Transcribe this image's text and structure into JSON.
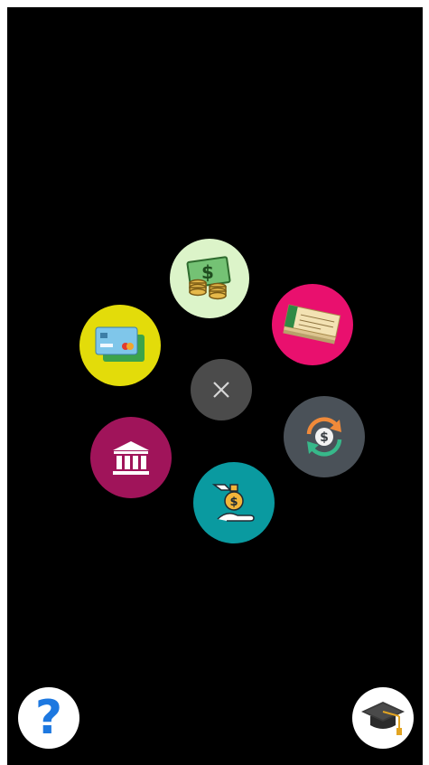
{
  "radial_menu": {
    "items": [
      {
        "icon": "cash-icon",
        "bg": "#dcf4c9"
      },
      {
        "icon": "cheque-icon",
        "bg": "#e9106e"
      },
      {
        "icon": "credit-card-icon",
        "bg": "#e3dc0a"
      },
      {
        "icon": "currency-exchange-icon",
        "bg": "#4a5158"
      },
      {
        "icon": "bank-icon",
        "bg": "#a0145a"
      },
      {
        "icon": "loan-icon",
        "bg": "#0a9aa0"
      }
    ],
    "close": {
      "icon": "close-icon",
      "label": "×",
      "bg": "#4b4b4b"
    }
  },
  "footer": {
    "help": {
      "icon": "help-icon",
      "label": "?",
      "color": "#1d78e0"
    },
    "learn": {
      "icon": "graduation-cap-icon"
    }
  },
  "colors": {
    "background": "#000000"
  }
}
